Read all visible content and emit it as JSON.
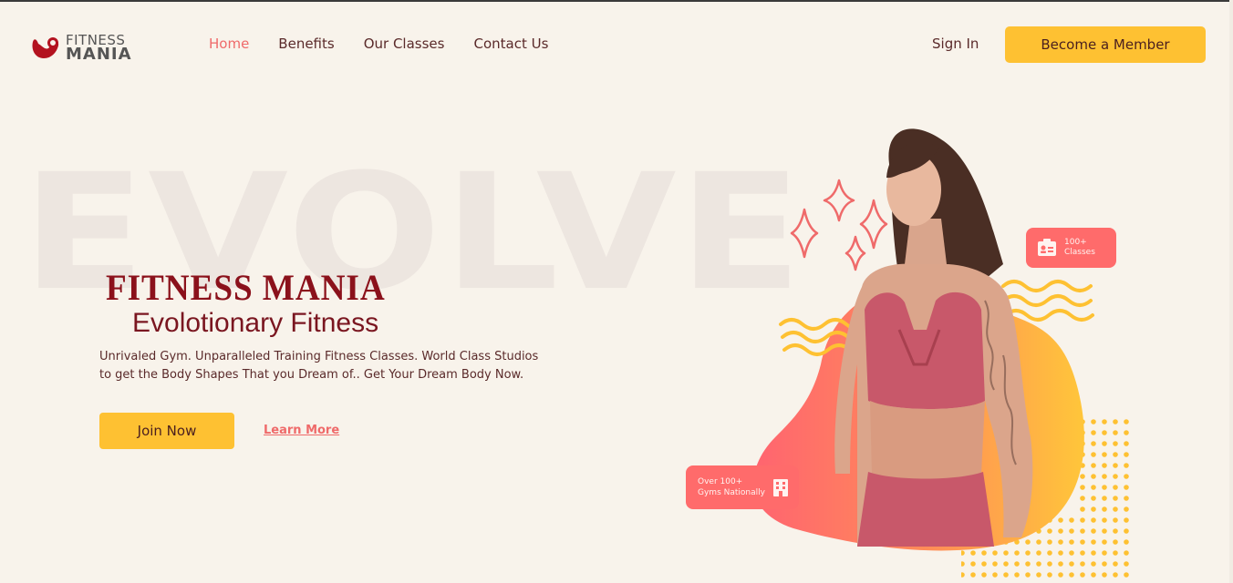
{
  "header": {
    "logo": {
      "line1": "FITNESS",
      "line2": "MANIA"
    },
    "nav": [
      {
        "label": "Home",
        "active": true
      },
      {
        "label": "Benefits",
        "active": false
      },
      {
        "label": "Our Classes",
        "active": false
      },
      {
        "label": "Contact Us",
        "active": false
      }
    ],
    "sign_in": "Sign In",
    "cta": "Become a Member"
  },
  "hero": {
    "background_word": "EVOLVE",
    "title": "FITNESS MANIA",
    "subtitle": "Evolotionary Fitness",
    "description_line1": "Unrivaled Gym. Unparalleled Training Fitness Classes. World Class Studios",
    "description_line2": "to get the Body Shapes That you Dream of.. Get Your Dream Body Now.",
    "primary_button": "Join Now",
    "secondary_link": "Learn More",
    "badge_classes": {
      "line1": "100+",
      "line2": "Classes",
      "icon": "id-card-icon"
    },
    "badge_gyms": {
      "line1": "Over 100+",
      "line2": "Gyms Nationally",
      "icon": "building-icon"
    }
  },
  "colors": {
    "background": "#f8f3eb",
    "accent_yellow": "#fec132",
    "accent_coral": "#ff6b6b",
    "brand_red": "#8b111b"
  }
}
